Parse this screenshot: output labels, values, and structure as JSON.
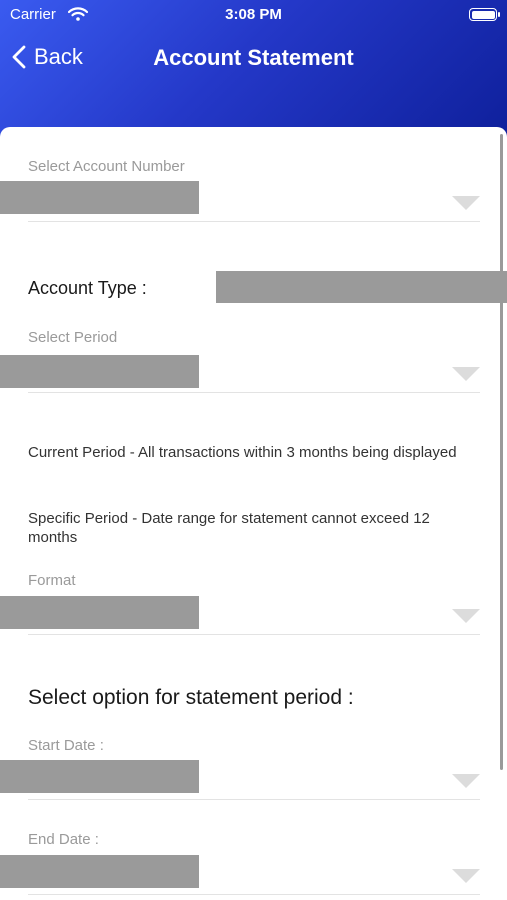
{
  "status_bar": {
    "carrier": "Carrier",
    "time": "3:08 PM"
  },
  "nav": {
    "back_label": "Back",
    "title": "Account Statement"
  },
  "form": {
    "account_number_label": "Select Account Number",
    "account_type_label": "Account Type :",
    "period_label": "Select Period",
    "info_current": "Current Period - All transactions within 3 months being displayed",
    "info_specific": "Specific Period - Date range for statement cannot exceed 12 months",
    "format_label": "Format",
    "statement_period_heading": "Select option for statement period :",
    "start_date_label": "Start Date :",
    "end_date_label": "End Date :"
  },
  "icons": {
    "back": "chevron-left-icon",
    "dropdown": "triangle-down-icon",
    "wifi": "wifi-icon",
    "battery": "battery-icon"
  },
  "colors": {
    "header_start": "#3a5bf0",
    "header_end": "#0e1f9a",
    "redacted": "#9a9a9a"
  }
}
